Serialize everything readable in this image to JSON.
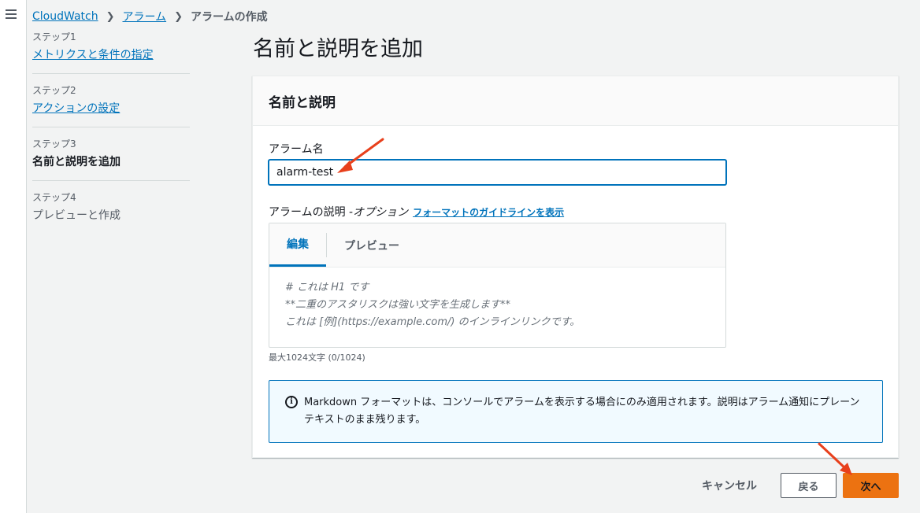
{
  "breadcrumb": {
    "items": [
      "CloudWatch",
      "アラーム"
    ],
    "current": "アラームの作成"
  },
  "steps": [
    {
      "label": "ステップ1",
      "name": "メトリクスと条件の指定"
    },
    {
      "label": "ステップ2",
      "name": "アクションの設定"
    },
    {
      "label": "ステップ3",
      "name": "名前と説明を追加"
    },
    {
      "label": "ステップ4",
      "name": "プレビューと作成"
    }
  ],
  "page": {
    "title": "名前と説明を追加"
  },
  "panel": {
    "title": "名前と説明",
    "alarm_name_label": "アラーム名",
    "alarm_name_value": "alarm-test",
    "description_label": "アラームの説明 - ",
    "description_optional": "オプション",
    "format_guide_link": "フォーマットのガイドラインを表示",
    "tabs": [
      "編集",
      "プレビュー"
    ],
    "placeholder_lines": [
      "# これは H1 です",
      "**二重のアスタリスクは強い文字を生成します**",
      "これは [例](https://example.com/) のインラインリンクです。"
    ],
    "char_limit": "最大1024文字 (0/1024)",
    "info_text": "Markdown フォーマットは、コンソールでアラームを表示する場合にのみ適用されます。説明はアラーム通知にプレーンテキストのまま残ります。"
  },
  "buttons": {
    "cancel": "キャンセル",
    "back": "戻る",
    "next": "次へ"
  },
  "colors": {
    "accent": "#0073bb",
    "primary_button": "#ec7211",
    "annotation_arrow": "#e8401c"
  }
}
